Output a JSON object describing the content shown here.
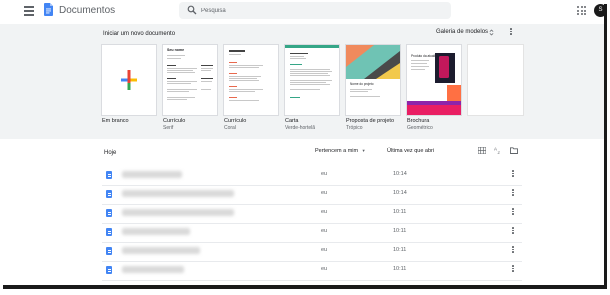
{
  "header": {
    "app_title": "Documentos",
    "search_placeholder": "Pesquisa",
    "avatar_initial": "S"
  },
  "templates": {
    "heading": "Iniciar um novo documento",
    "gallery_label": "Galeria de modelos",
    "items": [
      {
        "title": "Em branco",
        "subtitle": ""
      },
      {
        "title": "Currículo",
        "subtitle": "Serif"
      },
      {
        "title": "Currículo",
        "subtitle": "Coral"
      },
      {
        "title": "Carta",
        "subtitle": "Verde-hortelã"
      },
      {
        "title": "Proposta de projeto",
        "subtitle": "Trópico"
      },
      {
        "title": "Brochura",
        "subtitle": "Geométrico"
      }
    ],
    "thumb_texts": {
      "serif_name": "Seu nome",
      "proposal_name": "Nome do projeto",
      "brochure_name": "Produto da atualidade"
    }
  },
  "list": {
    "section_label": "Hoje",
    "owner_filter_label": "Pertencem a mim",
    "last_opened_label": "Última vez que abri",
    "rows": [
      {
        "owner": "eu",
        "opened": "10:14"
      },
      {
        "owner": "eu",
        "opened": "10:14"
      },
      {
        "owner": "eu",
        "opened": "10:11"
      },
      {
        "owner": "eu",
        "opened": "10:11"
      },
      {
        "owner": "eu",
        "opened": "10:11"
      },
      {
        "owner": "eu",
        "opened": "10:11"
      }
    ]
  },
  "colors": {
    "accent_blue": "#4285f4",
    "band_bg": "#f1f3f4",
    "plus_red": "#ea4335",
    "plus_yellow": "#fbbc04",
    "plus_green": "#34a853",
    "plus_blue": "#4285f4"
  },
  "icons": [
    "menu-icon",
    "docs-logo-icon",
    "search-icon",
    "apps-grid-icon",
    "unfold-icon",
    "more-vert-icon",
    "grid-view-icon",
    "sort-az-icon",
    "folder-icon",
    "document-icon"
  ]
}
